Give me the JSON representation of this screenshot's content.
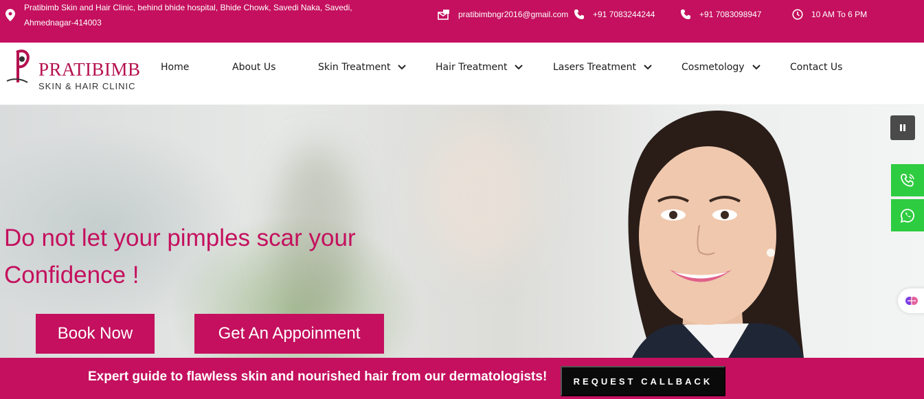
{
  "topbar": {
    "address": "Pratibimb Skin and Hair Clinic, behind bhide hospital, Bhide Chowk, Savedi Naka, Savedi, Ahmednagar-414003",
    "email": "pratibimbngr2016@gmail.com",
    "phone1": "+91 7083244244",
    "phone2": "+91 7083098947",
    "hours": "10 AM To 6 PM"
  },
  "logo": {
    "brand": "PRATIBIMB",
    "tagline": "SKIN & HAIR CLINIC"
  },
  "nav": {
    "home": "Home",
    "about": "About Us",
    "skin": "Skin Treatment",
    "hair": "Hair Treatment",
    "lasers": "Lasers Treatment",
    "cosmetology": "Cosmetology",
    "contact": "Contact Us"
  },
  "hero": {
    "headline_line1": "Do not let your pimples scar your",
    "headline_line2": "Confidence !",
    "book_now": "Book Now",
    "appointment": "Get An Appoinment"
  },
  "bottombar": {
    "message": "Expert guide to flawless skin and nourished hair from our dermatologists!",
    "callback": "REQUEST CALLBACK"
  },
  "colors": {
    "brand": "#c4105e",
    "whatsapp_green": "#2ecc40",
    "callback_bg": "#0a0a0a"
  }
}
